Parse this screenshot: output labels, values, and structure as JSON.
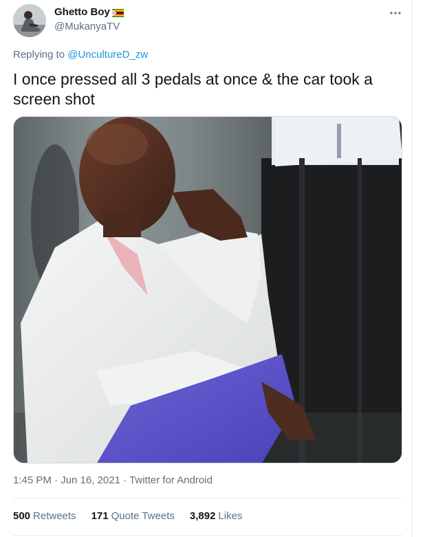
{
  "author": {
    "display_name": "Ghetto Boy",
    "handle": "@MukanyaTV",
    "flag_icon": "zimbabwe-flag-icon"
  },
  "menu_icon": "more-horizontal-icon",
  "reply_context": {
    "prefix": "Replying to ",
    "mention": "@UncultureD_zw"
  },
  "tweet": {
    "text": "I once pressed all 3 pedals at once & the car took a screen shot"
  },
  "media": {
    "icon": "photo"
  },
  "meta": {
    "time": "1:45 PM",
    "sep1": " · ",
    "date": "Jun 16, 2021",
    "sep2": " · ",
    "source": "Twitter for Android"
  },
  "stats": {
    "retweets_count": "500",
    "retweets_label": "Retweets",
    "quotes_count": "171",
    "quotes_label": "Quote Tweets",
    "likes_count": "3,892",
    "likes_label": "Likes"
  },
  "colors": {
    "link": "#1b95e0",
    "secondary_text": "#5b7083",
    "primary_text": "#0f1419",
    "divider": "#e6ecf0"
  }
}
